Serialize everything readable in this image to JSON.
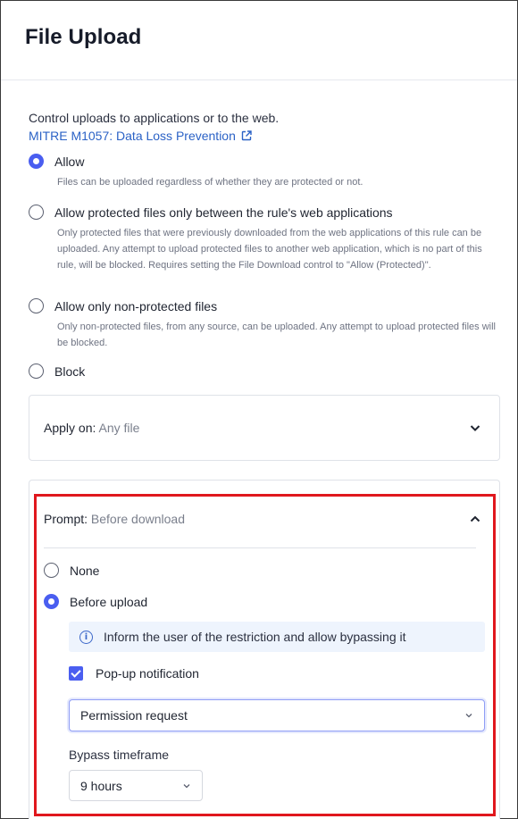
{
  "header": {
    "title": "File Upload"
  },
  "intro": {
    "description": "Control uploads to applications or to the web.",
    "link_label": "MITRE M1057: Data Loss Prevention"
  },
  "upload_options": [
    {
      "label": "Allow",
      "checked": true,
      "help": "Files can be uploaded regardless of whether they are protected or not."
    },
    {
      "label": "Allow protected files only between the rule's web applications",
      "checked": false,
      "help": "Only protected files that were previously downloaded from the web applications of this rule can be uploaded. Any attempt to upload protected files to another web application, which is no part of this rule, will be blocked. Requires setting the File Download control to \"Allow (Protected)\"."
    },
    {
      "label": "Allow only non-protected files",
      "checked": false,
      "help": "Only non-protected files, from any source, can be uploaded. Any attempt to upload protected files will be blocked."
    },
    {
      "label": "Block",
      "checked": false,
      "help": ""
    }
  ],
  "apply_on": {
    "label": "Apply on:",
    "value": "Any file"
  },
  "prompt": {
    "label": "Prompt:",
    "value": "Before download",
    "options": [
      {
        "label": "None",
        "checked": false
      },
      {
        "label": "Before upload",
        "checked": true
      }
    ],
    "info_text": "Inform the user of the restriction and allow bypassing it",
    "popup_label": "Pop-up notification",
    "popup_checked": true,
    "notification_type": "Permission request",
    "bypass_label": "Bypass timeframe",
    "bypass_value": "9 hours"
  },
  "colors": {
    "accent": "#4a5ef0",
    "link": "#2b62c6",
    "highlight": "#e0171d",
    "info_bg": "#eef4fd"
  }
}
